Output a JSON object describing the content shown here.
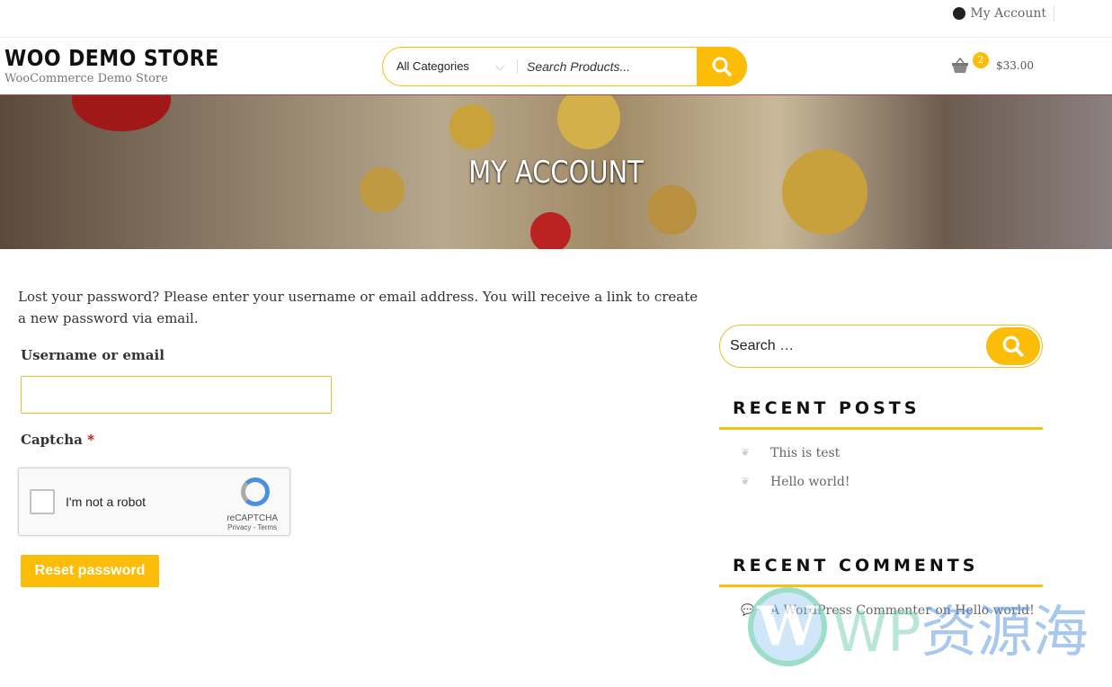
{
  "topbar": {
    "my_account": "My Account"
  },
  "header": {
    "site_title": "WOO DEMO STORE",
    "tagline": "WooCommerce Demo Store",
    "search": {
      "category": "All Categories",
      "placeholder": "Search Products..."
    },
    "cart": {
      "count": "2",
      "total": "$33.00"
    }
  },
  "hero": {
    "title": "MY ACCOUNT"
  },
  "main": {
    "intro": "Lost your password? Please enter your username or email address. You will receive a link to create a new password via email.",
    "username_label": "Username or email",
    "username_value": "",
    "captcha_label": "Captcha",
    "required_mark": "*",
    "recaptcha": {
      "text": "I'm not a robot",
      "brand": "reCAPTCHA",
      "links": "Privacy - Terms"
    },
    "reset_button": "Reset password"
  },
  "sidebar": {
    "search_placeholder": "Search …",
    "recent_posts_title": "RECENT POSTS",
    "recent_posts": [
      "This is test",
      "Hello world!"
    ],
    "recent_comments_title": "RECENT COMMENTS",
    "recent_comment": "A WordPress Commenter on Hello world!"
  },
  "watermark": {
    "text": "WP资源海"
  },
  "colors": {
    "accent": "#fbbd08"
  }
}
